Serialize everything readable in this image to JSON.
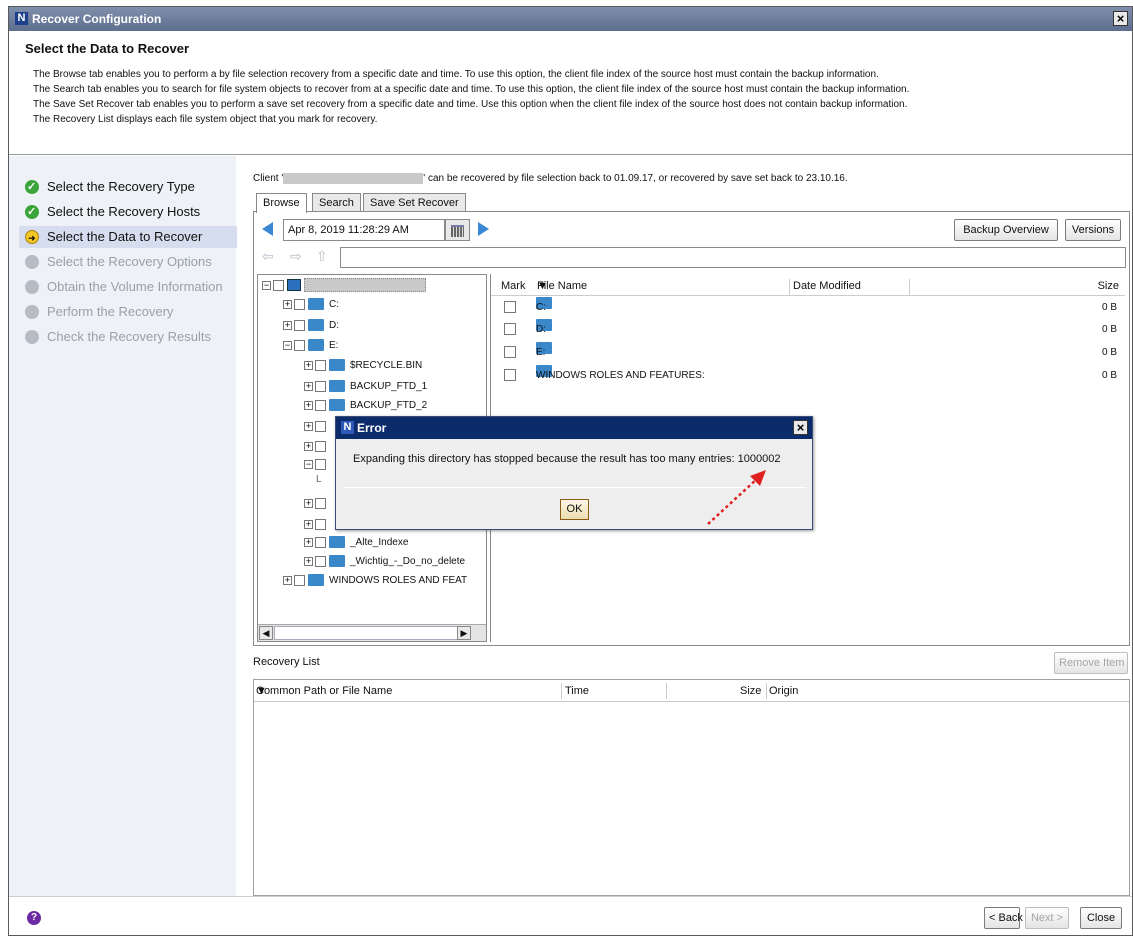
{
  "window": {
    "title": "Recover Configuration",
    "logo_letter": "N"
  },
  "header": {
    "title": "Select the Data to Recover",
    "lines": [
      "The Browse tab enables you to perform a by file selection recovery from a specific date and time. To use this option, the client file index of the source host must contain the backup information.",
      "The Search tab enables you to search for file system objects to recover from at a specific date and time. To use this option, the client file index of the source host must contain the backup information.",
      "The Save Set Recover tab enables you to perform a save set recovery from a specific date and time.  Use this option when the client file index of the source host does not contain backup information.",
      "The Recovery List displays each file system object that you mark for recovery."
    ]
  },
  "steps": [
    {
      "label": "Select the Recovery Type",
      "state": "done"
    },
    {
      "label": "Select the Recovery Hosts",
      "state": "done"
    },
    {
      "label": "Select the Data to Recover",
      "state": "current"
    },
    {
      "label": "Select the Recovery Options",
      "state": "todo"
    },
    {
      "label": "Obtain the Volume Information",
      "state": "todo"
    },
    {
      "label": "Perform the Recovery",
      "state": "todo"
    },
    {
      "label": "Check the Recovery Results",
      "state": "todo"
    }
  ],
  "client_line": {
    "prefix": "Client '",
    "suffix": "' can be recovered by file selection back to 01.09.17, or recovered by save set back to 23.10.16."
  },
  "tabs": [
    "Browse",
    "Search",
    "Save Set Recover"
  ],
  "browse": {
    "date_value": "Apr 8, 2019 11:28:29 AM",
    "backup_overview_label": "Backup Overview",
    "versions_label": "Versions",
    "path_value": ""
  },
  "tree": {
    "drives": [
      "C:",
      "D:",
      "E:"
    ],
    "e_children": [
      "$RECYCLE.BIN",
      "BACKUP_FTD_1",
      "BACKUP_FTD_2",
      "_Alte_Indexe",
      "_Wichtig_-_Do_no_delete"
    ],
    "e_child_l": "L",
    "last": "WINDOWS ROLES AND FEAT"
  },
  "files": {
    "columns": {
      "mark": "Mark",
      "name": "File Name",
      "date": "Date Modified",
      "size": "Size"
    },
    "rows": [
      {
        "name": "C:",
        "size": "0 B"
      },
      {
        "name": "D:",
        "size": "0 B"
      },
      {
        "name": "E:",
        "size": "0 B"
      },
      {
        "name": "WINDOWS ROLES AND FEATURES:",
        "size": "0 B"
      }
    ]
  },
  "recovery_list": {
    "label": "Recovery List",
    "remove_label": "Remove Item",
    "columns": {
      "path": "Common Path or File Name",
      "time": "Time",
      "size": "Size",
      "origin": "Origin"
    }
  },
  "footer": {
    "back_label": "< Back",
    "next_label": "Next >",
    "close_label": "Close",
    "help_glyph": "?"
  },
  "dialog": {
    "title": "Error",
    "message": "Expanding this directory has stopped because the result has too many entries: 1000002",
    "ok_label": "OK"
  },
  "colors": {
    "title_bar": "#6f7f9e",
    "dialog_title": "#0b2b6b",
    "step_done": "#3aa53a",
    "step_current": "#f3c623",
    "annotation_arrow": "#e02020",
    "nav_arrow": "#3a88d4"
  }
}
